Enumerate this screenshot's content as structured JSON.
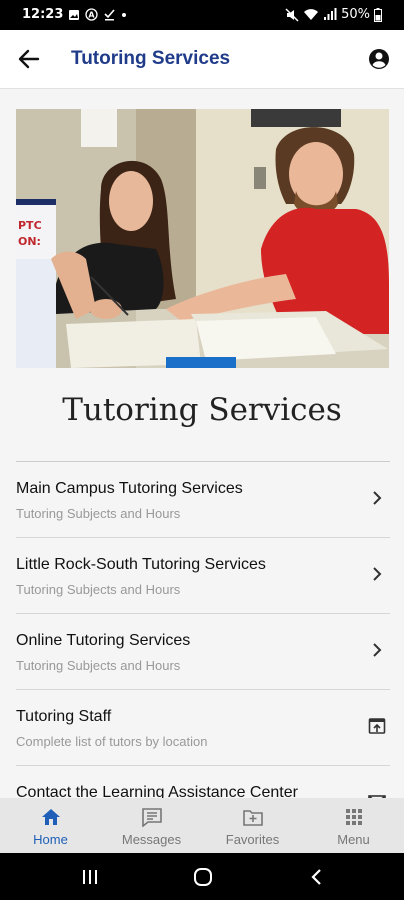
{
  "status_bar": {
    "time": "12:23",
    "battery": "50%"
  },
  "app_bar": {
    "title": "Tutoring Services"
  },
  "page": {
    "heading": "Tutoring Services"
  },
  "list": [
    {
      "title": "Main Campus Tutoring Services",
      "subtitle": "Tutoring Subjects and Hours",
      "icon": "chevron-right-icon"
    },
    {
      "title": "Little Rock-South Tutoring Services",
      "subtitle": "Tutoring Subjects and Hours",
      "icon": "chevron-right-icon"
    },
    {
      "title": "Online Tutoring Services",
      "subtitle": "Tutoring Subjects and Hours",
      "icon": "chevron-right-icon"
    },
    {
      "title": "Tutoring Staff",
      "subtitle": "Complete list of tutors by location",
      "icon": "open-external-icon"
    },
    {
      "title": "Contact the Learning Assistance Center",
      "subtitle": "",
      "icon": "mail-icon"
    }
  ],
  "bottom_nav": [
    {
      "label": "Home",
      "icon": "home-icon",
      "active": true
    },
    {
      "label": "Messages",
      "icon": "messages-icon",
      "active": false
    },
    {
      "label": "Favorites",
      "icon": "favorites-icon",
      "active": false
    },
    {
      "label": "Menu",
      "icon": "menu-grid-icon",
      "active": false
    }
  ],
  "colors": {
    "accent": "#1f3b8a",
    "nav_active": "#1f5fb8",
    "content_bg": "#f5f5f5"
  }
}
